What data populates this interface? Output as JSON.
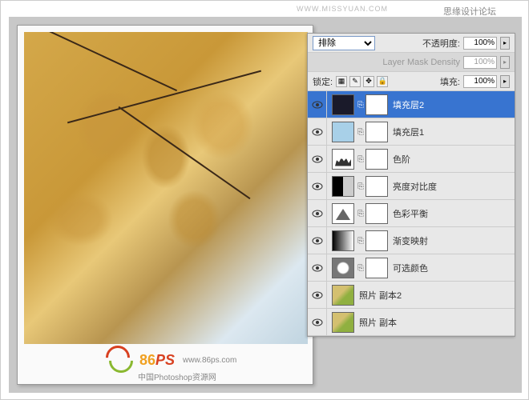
{
  "header": {
    "forum_text": "思缘设计论坛",
    "url_text": "WWW.MISSYUAN.COM"
  },
  "watermark": {
    "logo_main": "86",
    "logo_ps": "PS",
    "url": "www.86ps.com",
    "subtitle": "中国Photoshop资源网"
  },
  "panel": {
    "blend_mode": "排除",
    "opacity_label": "不透明度:",
    "opacity_value": "100%",
    "mask_density_label": "Layer Mask Density",
    "mask_density_value": "100%",
    "lock_label": "锁定:",
    "fill_label": "填充:",
    "fill_value": "100%",
    "layers": [
      {
        "name": "填充层2",
        "selected": true
      },
      {
        "name": "填充层1",
        "selected": false
      },
      {
        "name": "色阶",
        "selected": false
      },
      {
        "name": "亮度对比度",
        "selected": false
      },
      {
        "name": "色彩平衡",
        "selected": false
      },
      {
        "name": "渐变映射",
        "selected": false
      },
      {
        "name": "可选颜色",
        "selected": false
      },
      {
        "name": "照片 副本2",
        "selected": false
      },
      {
        "name": "照片 副本",
        "selected": false
      }
    ]
  }
}
